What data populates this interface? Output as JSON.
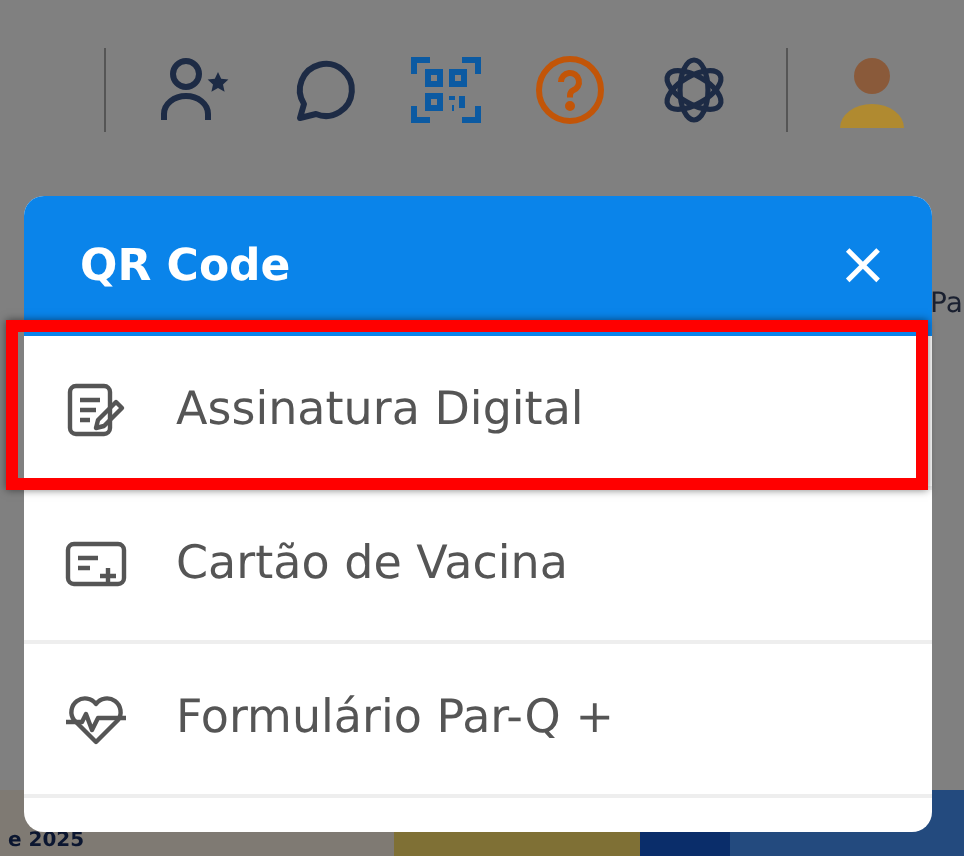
{
  "background": {
    "side_text": "Pa",
    "banner_text": "e 2025"
  },
  "popup": {
    "title": "QR Code",
    "close": "×",
    "items": [
      {
        "label": "Assinatura Digital",
        "kind": "signature",
        "highlighted": true
      },
      {
        "label": "Cartão de Vacina",
        "kind": "card",
        "highlighted": false
      },
      {
        "label": "Formulário Par-Q +",
        "kind": "heart",
        "highlighted": false
      }
    ]
  }
}
